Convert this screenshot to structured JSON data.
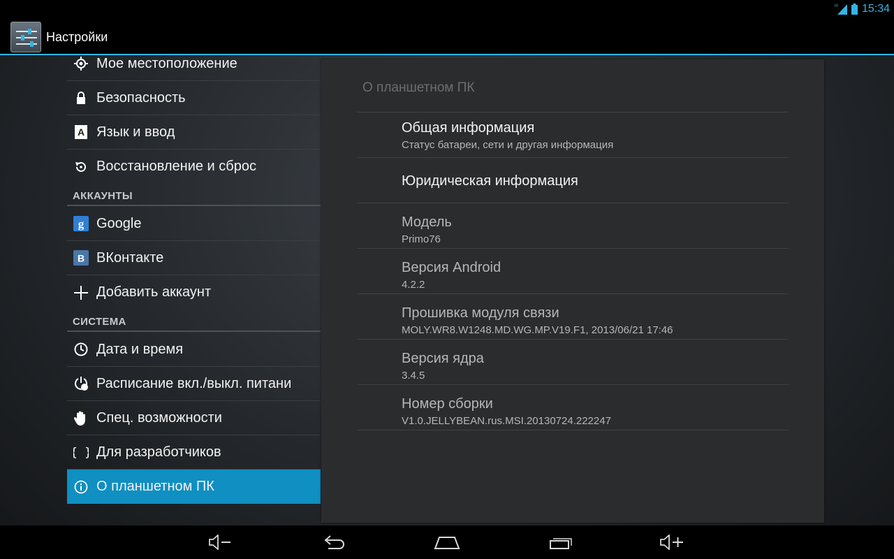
{
  "status_bar": {
    "time": "15:34",
    "network_label": "H",
    "icons": [
      "signal-icon",
      "battery-icon"
    ]
  },
  "action_bar": {
    "title": "Настройки",
    "icon": "settings-app-icon"
  },
  "sidebar": {
    "items": [
      {
        "label": "Мое местоположение",
        "icon": "location-icon"
      },
      {
        "label": "Безопасность",
        "icon": "lock-icon"
      },
      {
        "label": "Язык и ввод",
        "icon": "keyboard-a-icon"
      },
      {
        "label": "Восстановление и сброс",
        "icon": "restore-icon"
      },
      {
        "label": "Google",
        "icon": "google-icon"
      },
      {
        "label": "ВКонтакте",
        "icon": "vk-icon"
      },
      {
        "label": "Добавить аккаунт",
        "icon": "plus-icon"
      },
      {
        "label": "Дата и время",
        "icon": "clock-icon"
      },
      {
        "label": "Расписание вкл./выкл. питани",
        "icon": "power-schedule-icon"
      },
      {
        "label": "Спец. возможности",
        "icon": "hand-icon"
      },
      {
        "label": "Для разработчиков",
        "icon": "braces-icon"
      },
      {
        "label": "О планшетном ПК",
        "icon": "info-icon",
        "selected": true
      }
    ],
    "section_accounts": "АККАУНТЫ",
    "section_system": "СИСТЕМА"
  },
  "detail": {
    "title": "О планшетном ПК",
    "rows": [
      {
        "title": "Общая информация",
        "subtitle": "Статус батареи, сети и другая информация"
      },
      {
        "title": "Юридическая информация",
        "subtitle": ""
      },
      {
        "title": "Модель",
        "subtitle": "Primo76"
      },
      {
        "title": "Версия Android",
        "subtitle": "4.2.2"
      },
      {
        "title": "Прошивка модуля связи",
        "subtitle": "MOLY.WR8.W1248.MD.WG.MP.V19.F1, 2013/06/21 17:46"
      },
      {
        "title": "Версия ядра",
        "subtitle": "3.4.5"
      },
      {
        "title": "Номер сборки",
        "subtitle": "V1.0.JELLYBEAN.rus.MSI.20130724.222247"
      }
    ]
  },
  "nav_bar": {
    "buttons": [
      "volume-down-icon",
      "back-icon",
      "home-icon",
      "recent-apps-icon",
      "volume-up-icon"
    ]
  },
  "colors": {
    "accent": "#33b5e5",
    "selected_row": "#0f8fc2",
    "panel_bg": "#2b2c2e"
  }
}
